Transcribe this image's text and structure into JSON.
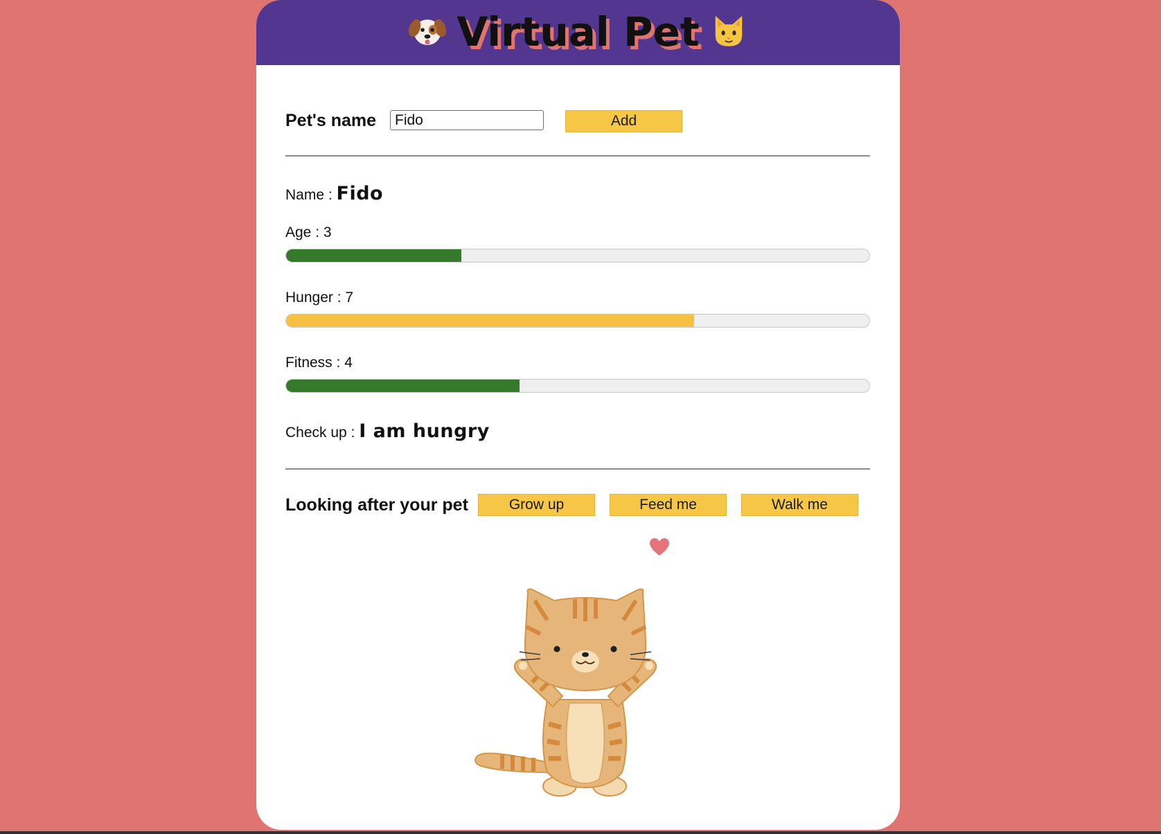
{
  "app": {
    "title": "Virtual Pet",
    "left_icon": "dog-face-icon",
    "right_icon": "cat-face-icon"
  },
  "add_pet": {
    "label": "Pet's name",
    "input_value": "Fido",
    "button_label": "Add"
  },
  "stats": {
    "name_label": "Name : ",
    "name_value": "Fido",
    "age_label": "Age : 3",
    "age_value": 3,
    "hunger_label": "Hunger : 7",
    "hunger_value": 7,
    "fitness_label": "Fitness : 4",
    "fitness_value": 4,
    "max_value": 10,
    "checkup_label": "Check up : ",
    "checkup_value": "I am hungry"
  },
  "care": {
    "label": "Looking after your pet",
    "buttons": [
      "Grow up",
      "Feed me",
      "Walk me"
    ]
  },
  "illustration": {
    "pet_icon": "cat-illustration",
    "heart_icon": "heart-icon"
  },
  "colors": {
    "background": "#e07470",
    "header": "#52368f",
    "button": "#f6c646",
    "bar_green": "#357a2a",
    "bar_yellow": "#f6c143",
    "bar_track": "#efefef"
  }
}
